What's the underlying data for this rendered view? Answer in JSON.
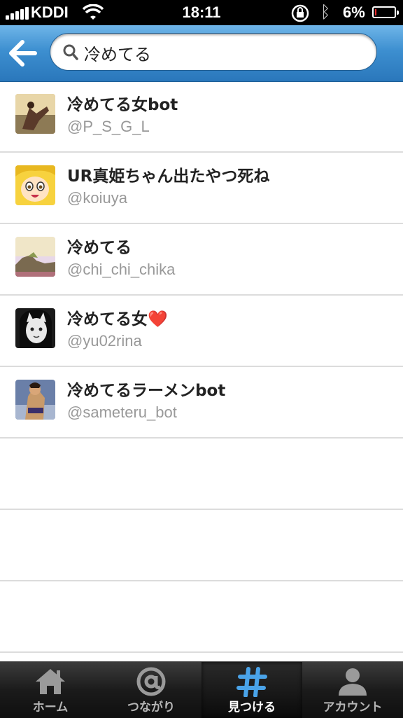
{
  "status_bar": {
    "carrier": "KDDI",
    "time": "18:11",
    "battery_percent": "6%",
    "battery_level": 0.06,
    "icons": [
      "signal-icon",
      "wifi-icon",
      "rotation-lock-icon",
      "bluetooth-icon",
      "battery-icon"
    ]
  },
  "nav": {
    "back_icon": "back-arrow-icon",
    "search": {
      "value": "冷めてる",
      "placeholder": "",
      "icon": "search-icon"
    }
  },
  "results": [
    {
      "name": "冷めてる女bot",
      "handle": "@P_S_G_L"
    },
    {
      "name": "UR真姫ちゃん出たやつ死ね",
      "handle": "@koiuya"
    },
    {
      "name": "冷めてる",
      "handle": "@chi_chi_chika"
    },
    {
      "name": "冷めてる女",
      "name_suffix": "❤️",
      "handle": "@yu02rina"
    },
    {
      "name": "冷めてるラーメンbot",
      "handle": "@sameteru_bot"
    }
  ],
  "tabs": [
    {
      "label": "ホーム",
      "icon": "home-icon",
      "active": false
    },
    {
      "label": "つながり",
      "icon": "at-sign-icon",
      "active": false
    },
    {
      "label": "見つける",
      "icon": "hashtag-icon",
      "active": true
    },
    {
      "label": "アカウント",
      "icon": "account-icon",
      "active": false
    }
  ],
  "colors": {
    "nav_blue": "#3d8fd0",
    "active_tab_blue": "#4aa3e8",
    "handle_gray": "#999999"
  }
}
